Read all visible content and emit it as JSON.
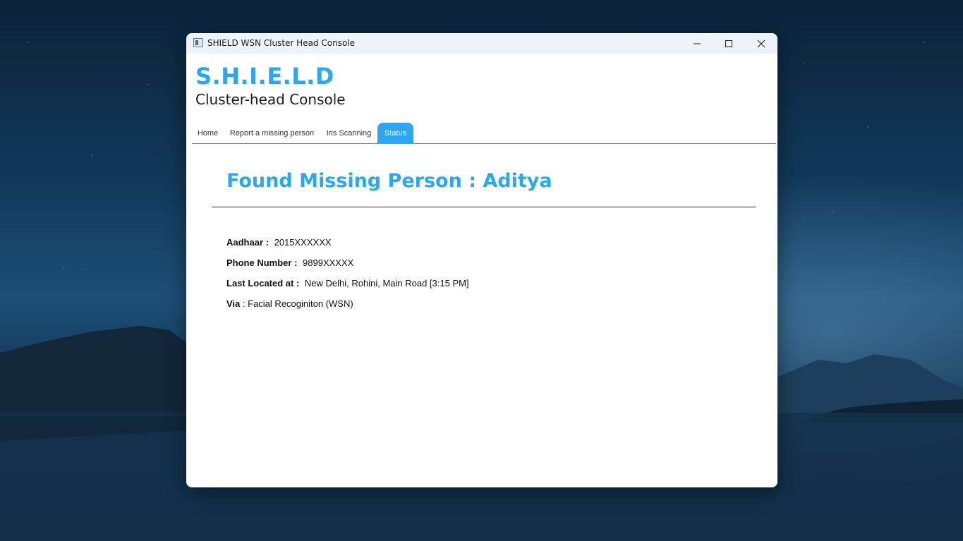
{
  "window": {
    "title": "SHIELD WSN Cluster Head Console",
    "controls": {
      "minimize_icon": "minimize-icon",
      "maximize_icon": "maximize-icon",
      "close_icon": "close-icon"
    }
  },
  "header": {
    "brand": "S.H.I.E.L.D",
    "subtitle": "Cluster-head Console"
  },
  "tabs": [
    {
      "label": "Home",
      "active": false
    },
    {
      "label": "Report a missing person",
      "active": false
    },
    {
      "label": "Iris Scanning",
      "active": false
    },
    {
      "label": "Status",
      "active": true
    }
  ],
  "status": {
    "title": "Found Missing Person : Aditya",
    "fields": [
      {
        "label": "Aadhaar :",
        "value": "2015XXXXXX"
      },
      {
        "label": "Phone Number :",
        "value": "9899XXXXX"
      },
      {
        "label": "Last Located at :",
        "value": "New Delhi, Rohini, Main Road [3:15 PM]"
      },
      {
        "label": "Via",
        "separator": " : ",
        "value": "Facial Recoginiton (WSN)"
      }
    ]
  },
  "colors": {
    "accent": "#2aa7f0",
    "text": "#1c1c1c",
    "titlebar": "#eef3f9"
  }
}
